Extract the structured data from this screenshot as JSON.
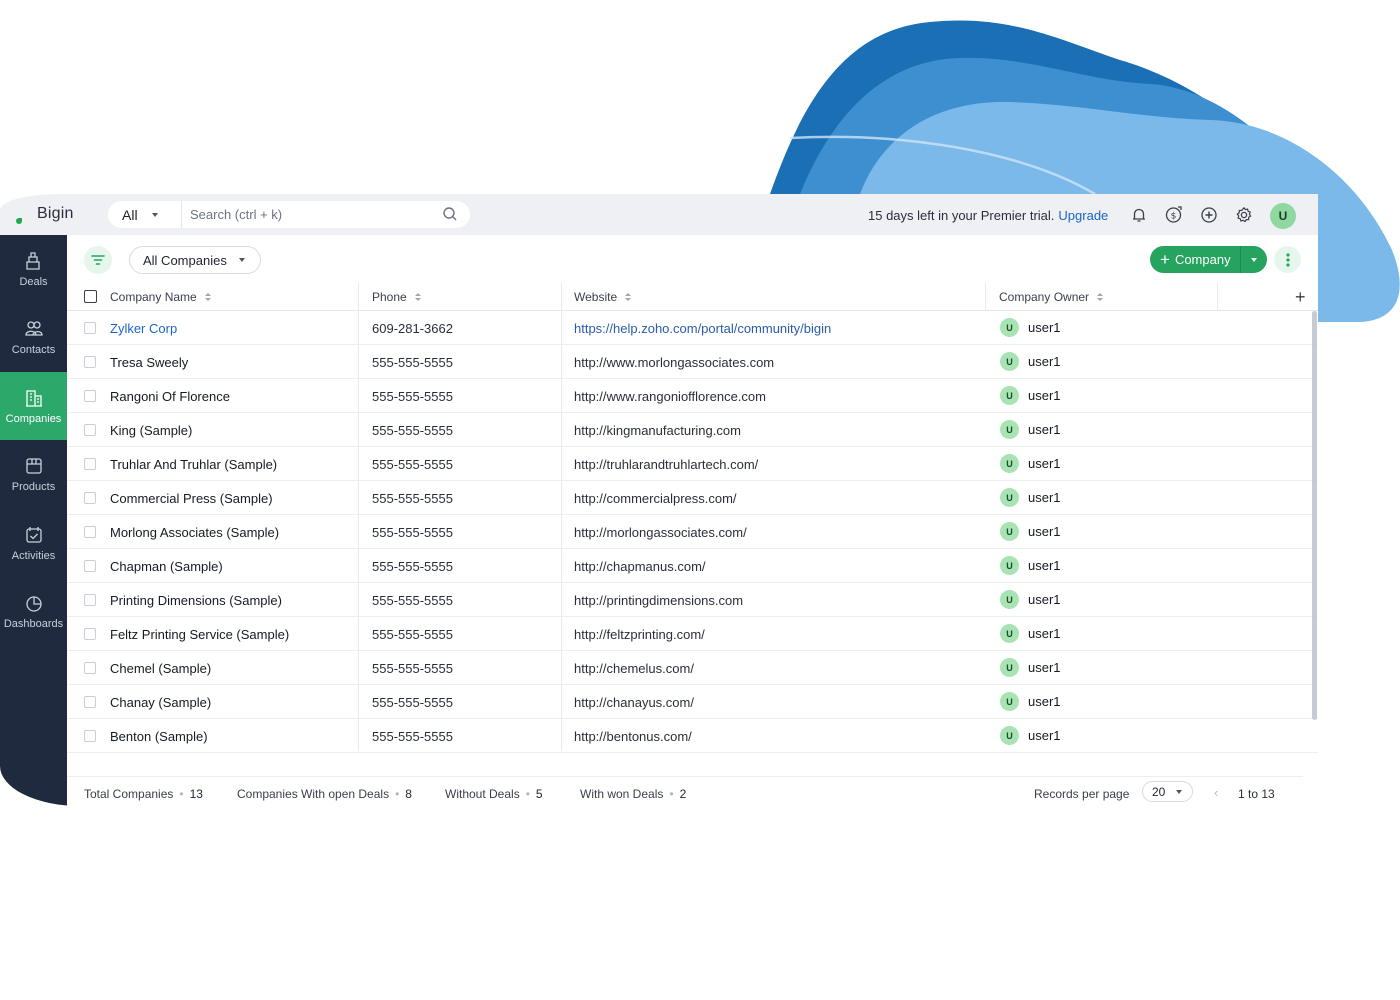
{
  "app": {
    "brand": "Bigin"
  },
  "search": {
    "scope": "All",
    "placeholder": "Search (ctrl + k)"
  },
  "trial": {
    "message": "15 days left in your Premier trial.",
    "upgrade": "Upgrade"
  },
  "user": {
    "initial": "U"
  },
  "top_icons": [
    "bell-icon",
    "money-icon",
    "plus-circle-icon",
    "settings-icon"
  ],
  "sidebar": {
    "items": [
      {
        "label": "Deals",
        "icon": "deals-icon",
        "active": false
      },
      {
        "label": "Contacts",
        "icon": "contacts-icon",
        "active": false
      },
      {
        "label": "Companies",
        "icon": "companies-icon",
        "active": true
      },
      {
        "label": "Products",
        "icon": "products-icon",
        "active": false
      },
      {
        "label": "Activities",
        "icon": "activities-icon",
        "active": false
      },
      {
        "label": "Dashboards",
        "icon": "dashboards-icon",
        "active": false
      }
    ]
  },
  "toolbar": {
    "view": "All Companies",
    "add_label": "Company"
  },
  "table": {
    "columns": [
      "Company Name",
      "Phone",
      "Website",
      "Company Owner"
    ],
    "rows": [
      {
        "name": "Zylker Corp",
        "phone": "609-281-3662",
        "website": "https://help.zoho.com/portal/community/bigin",
        "owner": "user1",
        "avatar": "U"
      },
      {
        "name": "Tresa Sweely",
        "phone": "555-555-5555",
        "website": "http://www.morlongassociates.com",
        "owner": "user1",
        "avatar": "U"
      },
      {
        "name": "Rangoni Of Florence",
        "phone": "555-555-5555",
        "website": "http://www.rangoniofflorence.com",
        "owner": "user1",
        "avatar": "U"
      },
      {
        "name": "King (Sample)",
        "phone": "555-555-5555",
        "website": "http://kingmanufacturing.com",
        "owner": "user1",
        "avatar": "U"
      },
      {
        "name": "Truhlar And Truhlar (Sample)",
        "phone": "555-555-5555",
        "website": "http://truhlarandtruhlartech.com/",
        "owner": "user1",
        "avatar": "U"
      },
      {
        "name": "Commercial Press (Sample)",
        "phone": "555-555-5555",
        "website": "http://commercialpress.com/",
        "owner": "user1",
        "avatar": "U"
      },
      {
        "name": "Morlong Associates (Sample)",
        "phone": "555-555-5555",
        "website": "http://morlongassociates.com/",
        "owner": "user1",
        "avatar": "U"
      },
      {
        "name": "Chapman (Sample)",
        "phone": "555-555-5555",
        "website": "http://chapmanus.com/",
        "owner": "user1",
        "avatar": "U"
      },
      {
        "name": "Printing Dimensions (Sample)",
        "phone": "555-555-5555",
        "website": "http://printingdimensions.com",
        "owner": "user1",
        "avatar": "U"
      },
      {
        "name": "Feltz Printing Service (Sample)",
        "phone": "555-555-5555",
        "website": "http://feltzprinting.com/",
        "owner": "user1",
        "avatar": "U"
      },
      {
        "name": "Chemel (Sample)",
        "phone": "555-555-5555",
        "website": "http://chemelus.com/",
        "owner": "user1",
        "avatar": "U"
      },
      {
        "name": "Chanay (Sample)",
        "phone": "555-555-5555",
        "website": "http://chanayus.com/",
        "owner": "user1",
        "avatar": "U"
      },
      {
        "name": "Benton (Sample)",
        "phone": "555-555-5555",
        "website": "http://bentonus.com/",
        "owner": "user1",
        "avatar": "U"
      }
    ]
  },
  "footer": {
    "stats": [
      {
        "label": "Total Companies",
        "value": "13"
      },
      {
        "label": "Companies With open Deals",
        "value": "8"
      },
      {
        "label": "Without Deals",
        "value": "5"
      },
      {
        "label": "With won Deals",
        "value": "2"
      }
    ],
    "records_per_page_label": "Records per page",
    "records_per_page": "20",
    "range": "1 to 13"
  },
  "colors": {
    "accent": "#26a35e",
    "sidebar": "#1f2a3e",
    "link": "#1a66c9",
    "wave_dark": "#1a6fb5",
    "wave_mid": "#3d8fd0",
    "wave_light": "#7bb9ea"
  }
}
